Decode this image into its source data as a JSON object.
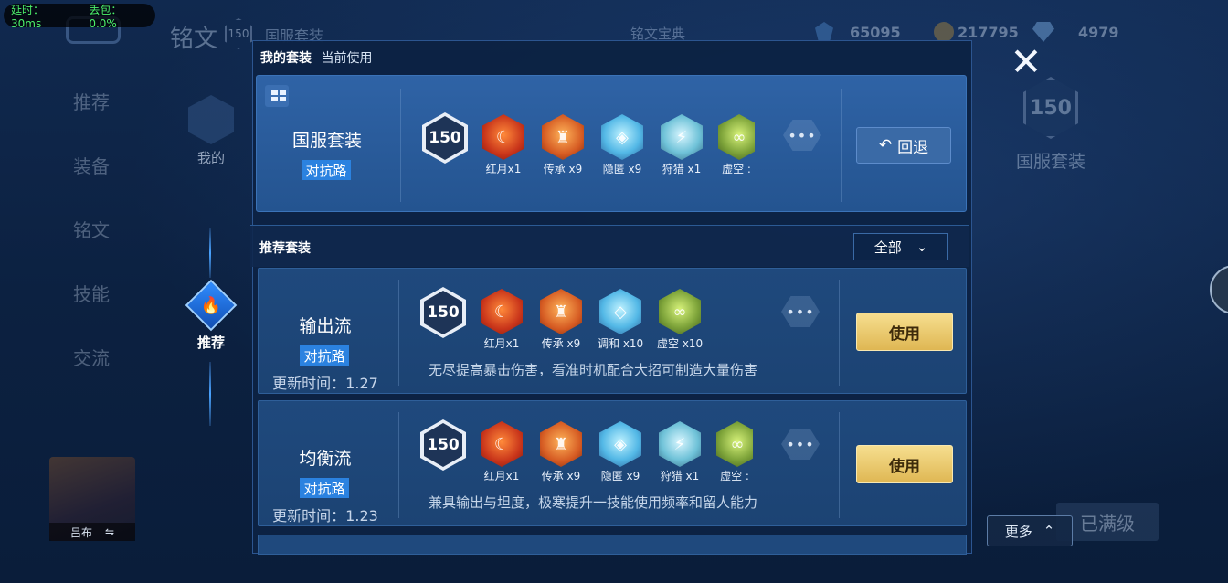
{
  "debug": {
    "latency": "延时：30ms",
    "packet_loss": "丢包：0.0%"
  },
  "topbar": {
    "title": "铭文",
    "level": "150",
    "set_name": "国服套装",
    "shop": "铭文宝典",
    "currency1": "65095",
    "currency2": "217795",
    "currency3": "4979"
  },
  "sidebar": {
    "items": [
      "推荐",
      "装备",
      "铭文",
      "技能",
      "交流"
    ]
  },
  "nav": {
    "mine_label": "我的",
    "recommend_label": "推荐"
  },
  "hero": {
    "name": "吕布"
  },
  "right_panel": {
    "level": "150",
    "set_name": "国服套装",
    "maxed_label": "已满级",
    "more_label": "更多"
  },
  "modal": {
    "my_sets_label": "我的套装",
    "current_label": "当前使用",
    "current_set": {
      "name": "国服套装",
      "lane": "对抗路",
      "level": "150",
      "runes": [
        {
          "label": "红月x1",
          "color": "red",
          "glyph": "☾"
        },
        {
          "label": "传承 x9",
          "color": "orange",
          "glyph": "♜"
        },
        {
          "label": "隐匿 x9",
          "color": "blue",
          "glyph": "◈"
        },
        {
          "label": "狩猎 x1",
          "color": "teal",
          "glyph": "⚡"
        },
        {
          "label": "虚空 :",
          "color": "green",
          "glyph": "∞"
        }
      ],
      "back_label": "回退"
    },
    "recommended_label": "推荐套装",
    "filter_label": "全部",
    "recommended_sets": [
      {
        "name": "输出流",
        "lane": "对抗路",
        "update_time": "更新时间：1.27",
        "level": "150",
        "runes": [
          {
            "label": "红月x1",
            "color": "red",
            "glyph": "☾"
          },
          {
            "label": "传承 x9",
            "color": "orange",
            "glyph": "♜"
          },
          {
            "label": "调和 x10",
            "color": "blue",
            "glyph": "◇"
          },
          {
            "label": "虚空 x10",
            "color": "green",
            "glyph": "∞"
          }
        ],
        "description": "无尽提高暴击伤害，看准时机配合大招可制造大量伤害",
        "use_label": "使用"
      },
      {
        "name": "均衡流",
        "lane": "对抗路",
        "update_time": "更新时间：1.23",
        "level": "150",
        "runes": [
          {
            "label": "红月x1",
            "color": "red",
            "glyph": "☾"
          },
          {
            "label": "传承 x9",
            "color": "orange",
            "glyph": "♜"
          },
          {
            "label": "隐匿 x9",
            "color": "blue",
            "glyph": "◈"
          },
          {
            "label": "狩猎 x1",
            "color": "teal",
            "glyph": "⚡"
          },
          {
            "label": "虚空 :",
            "color": "green",
            "glyph": "∞"
          }
        ],
        "description": "兼具输出与坦度，极寒提升一技能使用频率和留人能力",
        "use_label": "使用"
      }
    ]
  }
}
